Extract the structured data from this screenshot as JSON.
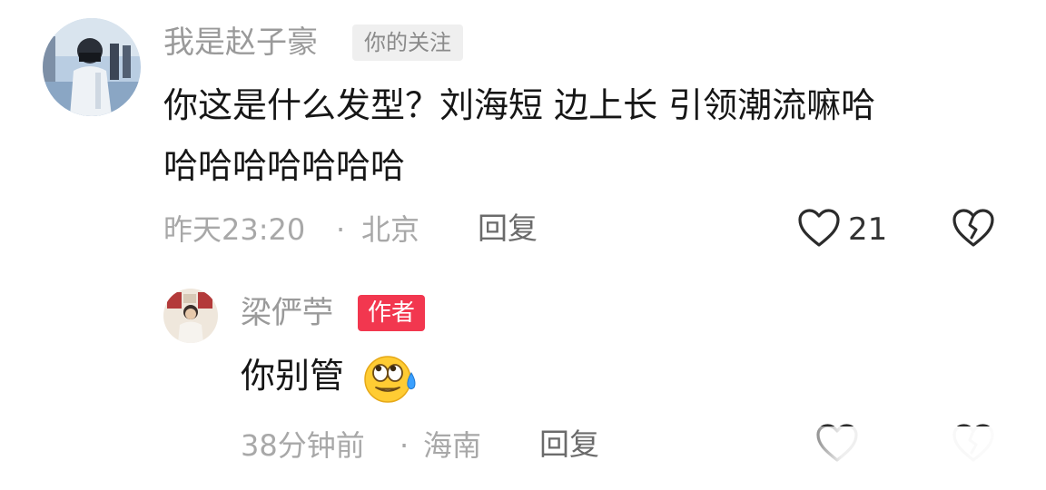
{
  "comments": [
    {
      "username": "我是赵子豪",
      "tag": "你的关注",
      "text_line1": "你这是什么发型？刘海短 边上长 引领潮流嘛哈",
      "text_line2": "哈哈哈哈哈哈哈",
      "time": "昨天23:20",
      "separator": "·",
      "location": "北京",
      "reply_label": "回复",
      "like_count": "21",
      "icons": {
        "like": "heart-outline-icon",
        "dislike": "broken-heart-icon"
      }
    },
    {
      "username": "梁俨苧",
      "tag": "作者",
      "text": "你别管",
      "emoji": "😰",
      "emoji_name": "sweat-rolling-eyes-emoji",
      "time": "38分钟前",
      "separator": "·",
      "location": "海南",
      "reply_label": "回复",
      "icons": {
        "like": "heart-outline-icon",
        "dislike": "broken-heart-icon"
      }
    }
  ],
  "colors": {
    "author_tag": "#f2374f",
    "username": "#9a9a9a",
    "text": "#161616",
    "meta": "#a8a8a8"
  }
}
